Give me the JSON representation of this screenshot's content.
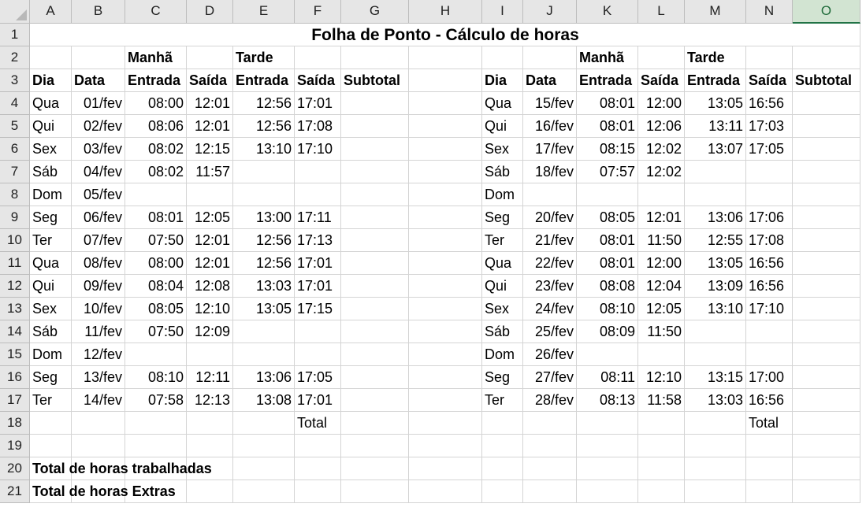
{
  "columns": [
    "A",
    "B",
    "C",
    "D",
    "E",
    "F",
    "G",
    "H",
    "I",
    "J",
    "K",
    "L",
    "M",
    "N",
    "O"
  ],
  "selected_column": "O",
  "rows": [
    "1",
    "2",
    "3",
    "4",
    "5",
    "6",
    "7",
    "8",
    "9",
    "10",
    "11",
    "12",
    "13",
    "14",
    "15",
    "16",
    "17",
    "18",
    "19",
    "20",
    "21"
  ],
  "title": "Folha de Ponto - Cálculo de horas",
  "group_labels": {
    "morning": "Manhã",
    "afternoon": "Tarde"
  },
  "headers": [
    "Dia",
    "Data",
    "Entrada",
    "Saída",
    "Entrada",
    "Saída",
    "Subtotal"
  ],
  "left_entries": [
    [
      "Qua",
      "01/fev",
      "08:00",
      "12:01",
      "12:56",
      "17:01"
    ],
    [
      "Qui",
      "02/fev",
      "08:06",
      "12:01",
      "12:56",
      "17:08"
    ],
    [
      "Sex",
      "03/fev",
      "08:02",
      "12:15",
      "13:10",
      "17:10"
    ],
    [
      "Sáb",
      "04/fev",
      "08:02",
      "11:57",
      "",
      ""
    ],
    [
      "Dom",
      "05/fev",
      "",
      "",
      "",
      ""
    ],
    [
      "Seg",
      "06/fev",
      "08:01",
      "12:05",
      "13:00",
      "17:11"
    ],
    [
      "Ter",
      "07/fev",
      "07:50",
      "12:01",
      "12:56",
      "17:13"
    ],
    [
      "Qua",
      "08/fev",
      "08:00",
      "12:01",
      "12:56",
      "17:01"
    ],
    [
      "Qui",
      "09/fev",
      "08:04",
      "12:08",
      "13:03",
      "17:01"
    ],
    [
      "Sex",
      "10/fev",
      "08:05",
      "12:10",
      "13:05",
      "17:15"
    ],
    [
      "Sáb",
      "11/fev",
      "07:50",
      "12:09",
      "",
      ""
    ],
    [
      "Dom",
      "12/fev",
      "",
      "",
      "",
      ""
    ],
    [
      "Seg",
      "13/fev",
      "08:10",
      "12:11",
      "13:06",
      "17:05"
    ],
    [
      "Ter",
      "14/fev",
      "07:58",
      "12:13",
      "13:08",
      "17:01"
    ]
  ],
  "right_entries": [
    [
      "Qua",
      "15/fev",
      "08:01",
      "12:00",
      "13:05",
      "16:56"
    ],
    [
      "Qui",
      "16/fev",
      "08:01",
      "12:06",
      "13:11",
      "17:03"
    ],
    [
      "Sex",
      "17/fev",
      "08:15",
      "12:02",
      "13:07",
      "17:05"
    ],
    [
      "Sáb",
      "18/fev",
      "07:57",
      "12:02",
      "",
      ""
    ],
    [
      "Dom",
      "",
      "",
      "",
      "",
      ""
    ],
    [
      "Seg",
      "20/fev",
      "08:05",
      "12:01",
      "13:06",
      "17:06"
    ],
    [
      "Ter",
      "21/fev",
      "08:01",
      "11:50",
      "12:55",
      "17:08"
    ],
    [
      "Qua",
      "22/fev",
      "08:01",
      "12:00",
      "13:05",
      "16:56"
    ],
    [
      "Qui",
      "23/fev",
      "08:08",
      "12:04",
      "13:09",
      "16:56"
    ],
    [
      "Sex",
      "24/fev",
      "08:10",
      "12:05",
      "13:10",
      "17:10"
    ],
    [
      "Sáb",
      "25/fev",
      "08:09",
      "11:50",
      "",
      ""
    ],
    [
      "Dom",
      "26/fev",
      "",
      "",
      "",
      ""
    ],
    [
      "Seg",
      "27/fev",
      "08:11",
      "12:10",
      "13:15",
      "17:00"
    ],
    [
      "Ter",
      "28/fev",
      "08:13",
      "11:58",
      "13:03",
      "16:56"
    ]
  ],
  "total_label": "Total",
  "summary": {
    "worked": "Total de horas trabalhadas",
    "extra": "Total de horas Extras"
  }
}
